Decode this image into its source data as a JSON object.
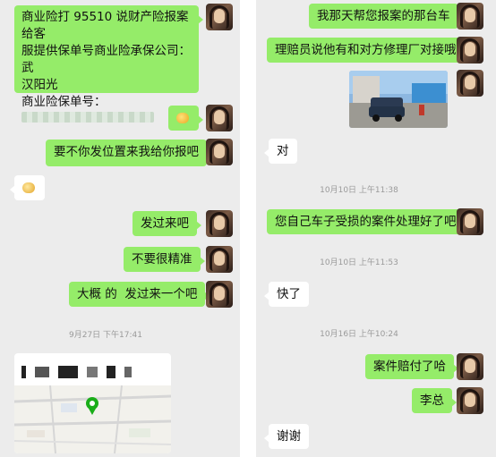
{
  "left_chat": {
    "msg1_lines": [
      "商业险打 95510 说财产险报案给客",
      "服提供保单号商业险承保公司：武",
      "汉阳光",
      "商业险保单号："
    ],
    "msg_emoji_icon": "smirk-emoji-icon",
    "msg2": "要不你发位置来我给你报吧",
    "msg_handshake_icon": "handshake-emoji-icon",
    "msg3": "发过来吧",
    "msg4": "不要很精准",
    "msg5": "大概 的  发过来一个吧",
    "time1": "9月27日 下午17:41"
  },
  "right_chat": {
    "msg1": "我那天帮您报案的那台车",
    "msg2": "理赔员说他有和对方修理厂对接哦",
    "msg3": "对",
    "time1": "10月10日 上午11:38",
    "msg4": "您自己车子受损的案件处理好了吧",
    "time2": "10月10日 上午11:53",
    "msg5": "快了",
    "time3": "10月16日 上午10:24",
    "msg6": "案件赔付了哈",
    "msg7": "李总",
    "msg8": "谢谢"
  },
  "colors": {
    "sent_bubble": "#95ec69",
    "received_bubble": "#ffffff",
    "background": "#ececec"
  }
}
